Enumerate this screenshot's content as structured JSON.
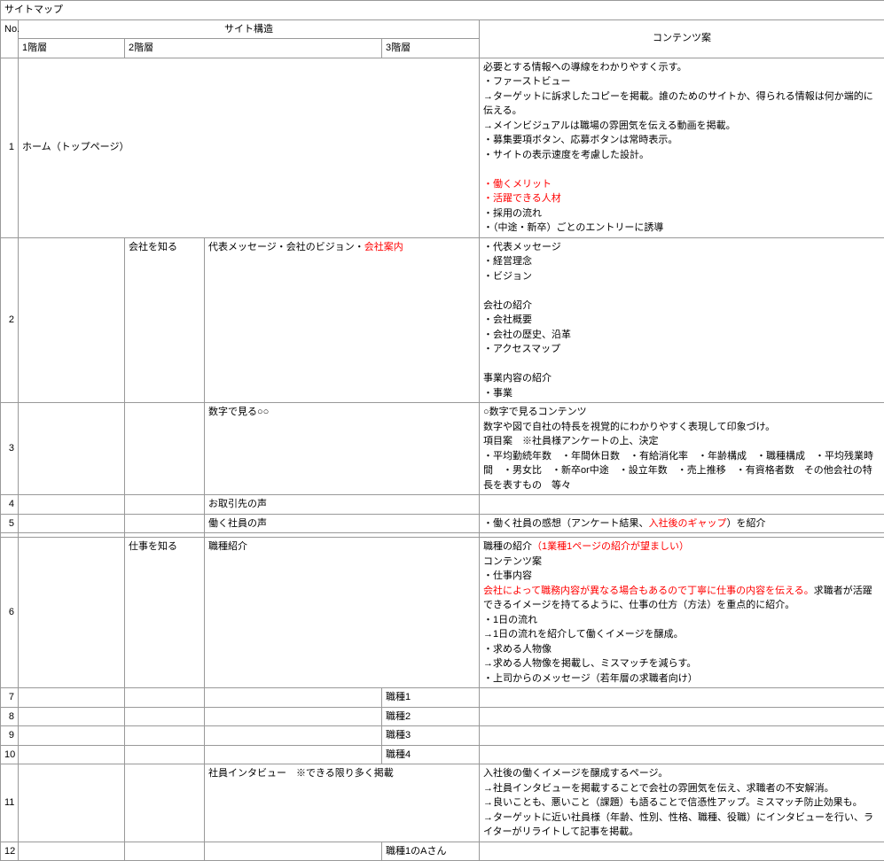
{
  "title": "サイトマップ",
  "headers": {
    "no": "No.",
    "structure": "サイト構造",
    "lv1": "1階層",
    "lv2": "2階層",
    "lv3": "3階層",
    "content": "コンテンツ案"
  },
  "rows": {
    "r1": {
      "no": "1",
      "lv1": "ホーム（トップページ）",
      "content_pre": "必要とする情報への導線をわかりやすく示す。\n・ファーストビュー\n→ターゲットに訴求したコピーを掲載。誰のためのサイトか、得られる情報は何か端的に伝える。\n→メインビジュアルは職場の雰囲気を伝える動画を掲載。\n・募集要項ボタン、応募ボタンは常時表示。\n・サイトの表示速度を考慮した設計。",
      "content_red1": "・働くメリット\n・活躍できる人材",
      "content_post": "・採用の流れ\n・（中途・新卒）ごとのエントリーに誘導"
    },
    "r2": {
      "no": "2",
      "lv1": "",
      "lv2": "会社を知る",
      "lv2b_pre": "代表メッセージ・会社のビジョン・",
      "lv2b_red": "会社案内",
      "content": "・代表メッセージ\n・経営理念\n・ビジョン\n\n会社の紹介\n・会社概要\n・会社の歴史、沿革\n・アクセスマップ\n\n事業内容の紹介\n・事業"
    },
    "r3": {
      "no": "3",
      "lv2b": "数字で見る○○",
      "content": "○数字で見るコンテンツ\n数字や図で自社の特長を視覚的にわかりやすく表現して印象づけ。\n項目案　※社員様アンケートの上、決定\n・平均勤続年数　・年間休日数　・有給消化率　・年齢構成　・職種構成　・平均残業時間　・男女比　・新卒or中途　・設立年数　・売上推移　・有資格者数　その他会社の特長を表すもの　等々"
    },
    "r4": {
      "no": "4",
      "lv2b": "お取引先の声"
    },
    "r5": {
      "no": "5",
      "lv2b": "働く社員の声",
      "content_pre": "・働く社員の感想（アンケート結果、",
      "content_red": "入社後のギャップ",
      "content_post": "）を紹介"
    },
    "r6": {
      "no": "6",
      "lv2": "仕事を知る",
      "lv2b": "職種紹介",
      "content_pre": "職種の紹介",
      "content_red1": "（1業種1ページの紹介が望ましい）",
      "content_mid1": "コンテンツ案\n・仕事内容",
      "content_red2": "会社によって職務内容が異なる場合もあるので丁寧に仕事の内容を伝える。",
      "content_post": "求職者が活躍できるイメージを持てるように、仕事の仕方（方法）を重点的に紹介。\n・1日の流れ\n→1日の流れを紹介して働くイメージを醸成。\n・求める人物像\n→求める人物像を掲載し、ミスマッチを減らす。\n・上司からのメッセージ（若年層の求職者向け）"
    },
    "r7": {
      "no": "7",
      "lv3": "職種1"
    },
    "r8": {
      "no": "8",
      "lv3": "職種2"
    },
    "r9": {
      "no": "9",
      "lv3": "職種3"
    },
    "r10": {
      "no": "10",
      "lv3": "職種4"
    },
    "r11": {
      "no": "11",
      "lv2b": "社員インタビュー　※できる限り多く掲載",
      "content": "入社後の働くイメージを醸成するページ。\n→社員インタビューを掲載することで会社の雰囲気を伝え、求職者の不安解消。\n→良いことも、悪いこと（課題）も語ることで信憑性アップ。ミスマッチ防止効果も。\n→ターゲットに近い社員様（年齢、性別、性格、職種、役職）にインタビューを行い、ライターがリライトして記事を掲載。"
    },
    "r12": {
      "no": "12",
      "lv3": "職種1のAさん"
    }
  }
}
